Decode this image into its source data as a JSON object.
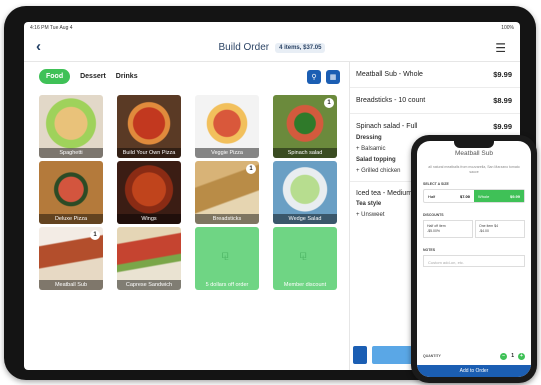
{
  "statusbar": {
    "time": "4:16 PM  Tue Aug 4",
    "battery": "100%"
  },
  "header": {
    "title": "Build Order",
    "badge": "4 items, $37.05"
  },
  "tabs": [
    "Food",
    "Dessert",
    "Drinks"
  ],
  "menu_items": [
    {
      "label": "Spaghetti",
      "count": ""
    },
    {
      "label": "Build Your Own Pizza",
      "count": ""
    },
    {
      "label": "Veggie Pizza",
      "count": ""
    },
    {
      "label": "Spinach salad",
      "count": "1"
    },
    {
      "label": "Deluxe Pizza",
      "count": ""
    },
    {
      "label": "Wings",
      "count": ""
    },
    {
      "label": "Breadsticks",
      "count": "1"
    },
    {
      "label": "Wedge Salad",
      "count": ""
    },
    {
      "label": "Meatball Sub",
      "count": "1"
    },
    {
      "label": "Caprese Sandwich",
      "count": ""
    },
    {
      "label": "5 dollars off order",
      "count": ""
    },
    {
      "label": "Member discount",
      "count": ""
    }
  ],
  "order": {
    "lines": [
      {
        "name": "Meatball Sub - Whole",
        "price": "$9.99"
      },
      {
        "name": "Breadsticks - 10 count",
        "price": "$8.99"
      },
      {
        "name": "Spinach salad - Full",
        "price": "$9.99"
      }
    ],
    "salad_details": [
      "Dressing",
      "+ Balsamic",
      "Salad topping",
      "+ Grilled chicken"
    ],
    "tea": {
      "name": "Iced tea - Medium"
    },
    "tea_details": [
      "Tea style",
      "+ Unsweet"
    ]
  },
  "phone": {
    "title": "Meatball Sub",
    "description": "all natural meatballs from mozzarella, San Marzano tomato sauce",
    "select_label": "SELECT A SIZE",
    "sizes": [
      {
        "name": "Half",
        "price": "$7.00"
      },
      {
        "name": "Whole",
        "price": "$9.99"
      }
    ],
    "discounts_label": "DISCOUNTS",
    "discounts": [
      {
        "name": "Half off item",
        "value": "-$5.00%"
      },
      {
        "name": "One item $4",
        "value": "-$4.00"
      }
    ],
    "notes_label": "NOTES",
    "notes_placeholder": "Custom add-on, etc.",
    "quantity_label": "QUANTITY",
    "quantity": "1",
    "add_button": "Add to Order"
  }
}
